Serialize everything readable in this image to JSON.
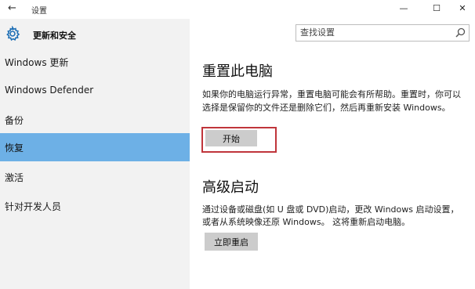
{
  "window": {
    "title": "设置",
    "back_glyph": "←",
    "minimize_glyph": "—",
    "maximize_glyph": "☐",
    "close_glyph": "✕"
  },
  "sidebar": {
    "header": "更新和安全",
    "items": [
      {
        "label": "Windows 更新",
        "active": false
      },
      {
        "label": "Windows Defender",
        "active": false
      },
      {
        "label": "备份",
        "active": false
      },
      {
        "label": "恢复",
        "active": true
      },
      {
        "label": "激活",
        "active": false
      },
      {
        "label": "针对开发人员",
        "active": false
      }
    ]
  },
  "search": {
    "placeholder": "查找设置"
  },
  "reset": {
    "title": "重置此电脑",
    "description": "如果你的电脑运行异常，重置电脑可能会有所帮助。重置时，你可以选择是保留你的文件还是删除它们，然后再重新安装 Windows。",
    "button_label": "开始"
  },
  "advanced": {
    "title": "高级启动",
    "description": "通过设备或磁盘(如 U 盘或 DVD)启动，更改 Windows 启动设置，或者从系统映像还原 Windows。 这将重新启动电脑。",
    "button_label": "立即重启"
  },
  "colors": {
    "accent": "#6db0e6",
    "highlight_border": "#c0353b",
    "button_bg": "#cccccc"
  }
}
